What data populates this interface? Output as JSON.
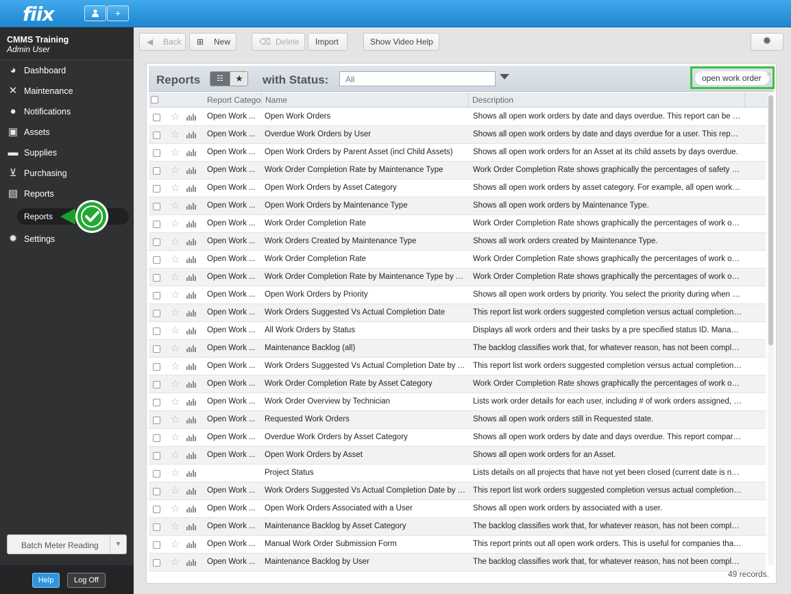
{
  "app": {
    "logo": "fiix"
  },
  "topbar": {
    "user_icon": "user-icon",
    "add_label": "+"
  },
  "sidebar": {
    "account_name": "CMMS Training",
    "account_role": "Admin User",
    "items": [
      {
        "label": "Dashboard",
        "icon": "dashboard-icon"
      },
      {
        "label": "Maintenance",
        "icon": "tools-icon"
      },
      {
        "label": "Notifications",
        "icon": "speech-bubble-icon"
      },
      {
        "label": "Assets",
        "icon": "box-icon"
      },
      {
        "label": "Supplies",
        "icon": "truck-icon"
      },
      {
        "label": "Purchasing",
        "icon": "cart-icon"
      },
      {
        "label": "Reports",
        "icon": "chart-icon"
      },
      {
        "label": "Settings",
        "icon": "gear-icon"
      }
    ],
    "subitem": "Reports",
    "batch_label": "Batch Meter Reading",
    "help_label": "Help",
    "logoff_label": "Log Off"
  },
  "toolbar": {
    "back": "Back",
    "new": "New",
    "delete": "Delete",
    "import": "Import",
    "video_help": "Show Video Help"
  },
  "panel": {
    "title": "Reports",
    "status_label": "with Status:",
    "status_value": "All",
    "search_value": "open work order"
  },
  "table": {
    "headers": {
      "category": "Report Category",
      "name": "Name",
      "description": "Description"
    },
    "rows": [
      {
        "cat": "Open Work ...",
        "name": "Open Work Orders",
        "desc": "Shows all open work orders by date and days overdue. This report can be cust..."
      },
      {
        "cat": "Open Work ...",
        "name": "Overdue Work Orders by User",
        "desc": "Shows all open work orders by date and days overdue for a user. This report c..."
      },
      {
        "cat": "Open Work ...",
        "name": "Open Work Orders by Parent Asset (incl Child Assets)",
        "desc": "Shows all open work orders for an Asset at its child assets by days overdue."
      },
      {
        "cat": "Open Work ...",
        "name": "Work Order Completion Rate by Maintenance Type",
        "desc": "Work Order Completion Rate shows graphically the percentages of safety work..."
      },
      {
        "cat": "Open Work ...",
        "name": "Open Work Orders by Asset Category",
        "desc": "Shows all open work orders by asset category. For example, all open work ord..."
      },
      {
        "cat": "Open Work ...",
        "name": "Open Work Orders by Maintenance Type",
        "desc": "Shows all open work orders by Maintenance Type."
      },
      {
        "cat": "Open Work ...",
        "name": "Work Order Completion Rate",
        "desc": "Work Order Completion Rate shows graphically the percentages of work order..."
      },
      {
        "cat": "Open Work ...",
        "name": "Work Orders Created by Maintenance Type",
        "desc": "Shows all work orders created by Maintenance Type."
      },
      {
        "cat": "Open Work ...",
        "name": "Work Order Completion Rate",
        "desc": "Work Order Completion Rate shows graphically the percentages of work order..."
      },
      {
        "cat": "Open Work ...",
        "name": "Work Order Completion Rate by Maintenance Type by Ass...",
        "desc": "Work Order Completion Rate shows graphically the percentages of work order..."
      },
      {
        "cat": "Open Work ...",
        "name": "Open Work Orders by Priority",
        "desc": "Shows all open work orders by priority. You select the priority during when run..."
      },
      {
        "cat": "Open Work ...",
        "name": "Work Orders Suggested Vs Actual Completion Date",
        "desc": "This report list work orders suggested completion versus actual completion dat..."
      },
      {
        "cat": "Open Work ...",
        "name": "All Work Orders by Status",
        "desc": "Displays all work orders and their tasks by a pre specified status ID. Managers..."
      },
      {
        "cat": "Open Work ...",
        "name": "Maintenance Backlog (all)",
        "desc": "The backlog classifies work that, for whatever reason, has not been completed..."
      },
      {
        "cat": "Open Work ...",
        "name": "Work Orders Suggested Vs Actual Completion Date by Ass...",
        "desc": "This report list work orders suggested completion versus actual completion dat..."
      },
      {
        "cat": "Open Work ...",
        "name": "Work Order Completion Rate by Asset Category",
        "desc": "Work Order Completion Rate shows graphically the percentages of work order..."
      },
      {
        "cat": "Open Work ...",
        "name": "Work Order Overview by Technician",
        "desc": "Lists work order details for each user, including # of work orders assigned, # ..."
      },
      {
        "cat": "Open Work ...",
        "name": "Requested Work Orders",
        "desc": "Shows all open work orders still in Requested state."
      },
      {
        "cat": "Open Work ...",
        "name": "Overdue Work Orders by Asset Category",
        "desc": "Shows all open work orders by date and days overdue. This report compares s..."
      },
      {
        "cat": "Open Work ...",
        "name": "Open Work Orders by Asset",
        "desc": "Shows all open work orders for an Asset."
      },
      {
        "cat": "",
        "name": "Project Status",
        "desc": "Lists details on all projects that have not yet been closed (current date is not p..."
      },
      {
        "cat": "Open Work ...",
        "name": "Work Orders Suggested Vs Actual Completion Date by User",
        "desc": "This report list work orders suggested completion versus actual completion dat..."
      },
      {
        "cat": "Open Work ...",
        "name": "Open Work Orders Associated with a User",
        "desc": "Shows all open work orders by associated with a user."
      },
      {
        "cat": "Open Work ...",
        "name": "Maintenance Backlog by Asset Category",
        "desc": "The backlog classifies work that, for whatever reason, has not been completed..."
      },
      {
        "cat": "Open Work ...",
        "name": "Manual Work Order Submission Form",
        "desc": "This report prints out all open work orders. This is useful for companies that st..."
      },
      {
        "cat": "Open Work ...",
        "name": "Maintenance Backlog by User",
        "desc": "The backlog classifies work that, for whatever reason, has not been completed..."
      }
    ],
    "records": "49 records."
  },
  "colors": {
    "accent": "#2f95e0",
    "highlight": "#3cc43c",
    "sidebar": "#2f3133"
  }
}
